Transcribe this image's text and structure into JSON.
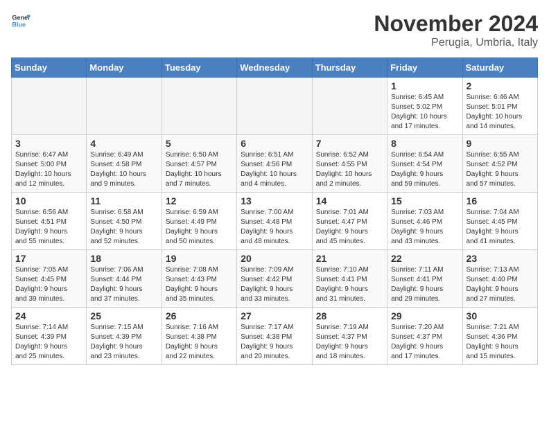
{
  "logo": {
    "text_general": "General",
    "text_blue": "Blue"
  },
  "header": {
    "month": "November 2024",
    "location": "Perugia, Umbria, Italy"
  },
  "weekdays": [
    "Sunday",
    "Monday",
    "Tuesday",
    "Wednesday",
    "Thursday",
    "Friday",
    "Saturday"
  ],
  "weeks": [
    [
      {
        "day": "",
        "info": ""
      },
      {
        "day": "",
        "info": ""
      },
      {
        "day": "",
        "info": ""
      },
      {
        "day": "",
        "info": ""
      },
      {
        "day": "",
        "info": ""
      },
      {
        "day": "1",
        "info": "Sunrise: 6:45 AM\nSunset: 5:02 PM\nDaylight: 10 hours\nand 17 minutes."
      },
      {
        "day": "2",
        "info": "Sunrise: 6:46 AM\nSunset: 5:01 PM\nDaylight: 10 hours\nand 14 minutes."
      }
    ],
    [
      {
        "day": "3",
        "info": "Sunrise: 6:47 AM\nSunset: 5:00 PM\nDaylight: 10 hours\nand 12 minutes."
      },
      {
        "day": "4",
        "info": "Sunrise: 6:49 AM\nSunset: 4:58 PM\nDaylight: 10 hours\nand 9 minutes."
      },
      {
        "day": "5",
        "info": "Sunrise: 6:50 AM\nSunset: 4:57 PM\nDaylight: 10 hours\nand 7 minutes."
      },
      {
        "day": "6",
        "info": "Sunrise: 6:51 AM\nSunset: 4:56 PM\nDaylight: 10 hours\nand 4 minutes."
      },
      {
        "day": "7",
        "info": "Sunrise: 6:52 AM\nSunset: 4:55 PM\nDaylight: 10 hours\nand 2 minutes."
      },
      {
        "day": "8",
        "info": "Sunrise: 6:54 AM\nSunset: 4:54 PM\nDaylight: 9 hours\nand 59 minutes."
      },
      {
        "day": "9",
        "info": "Sunrise: 6:55 AM\nSunset: 4:52 PM\nDaylight: 9 hours\nand 57 minutes."
      }
    ],
    [
      {
        "day": "10",
        "info": "Sunrise: 6:56 AM\nSunset: 4:51 PM\nDaylight: 9 hours\nand 55 minutes."
      },
      {
        "day": "11",
        "info": "Sunrise: 6:58 AM\nSunset: 4:50 PM\nDaylight: 9 hours\nand 52 minutes."
      },
      {
        "day": "12",
        "info": "Sunrise: 6:59 AM\nSunset: 4:49 PM\nDaylight: 9 hours\nand 50 minutes."
      },
      {
        "day": "13",
        "info": "Sunrise: 7:00 AM\nSunset: 4:48 PM\nDaylight: 9 hours\nand 48 minutes."
      },
      {
        "day": "14",
        "info": "Sunrise: 7:01 AM\nSunset: 4:47 PM\nDaylight: 9 hours\nand 45 minutes."
      },
      {
        "day": "15",
        "info": "Sunrise: 7:03 AM\nSunset: 4:46 PM\nDaylight: 9 hours\nand 43 minutes."
      },
      {
        "day": "16",
        "info": "Sunrise: 7:04 AM\nSunset: 4:45 PM\nDaylight: 9 hours\nand 41 minutes."
      }
    ],
    [
      {
        "day": "17",
        "info": "Sunrise: 7:05 AM\nSunset: 4:45 PM\nDaylight: 9 hours\nand 39 minutes."
      },
      {
        "day": "18",
        "info": "Sunrise: 7:06 AM\nSunset: 4:44 PM\nDaylight: 9 hours\nand 37 minutes."
      },
      {
        "day": "19",
        "info": "Sunrise: 7:08 AM\nSunset: 4:43 PM\nDaylight: 9 hours\nand 35 minutes."
      },
      {
        "day": "20",
        "info": "Sunrise: 7:09 AM\nSunset: 4:42 PM\nDaylight: 9 hours\nand 33 minutes."
      },
      {
        "day": "21",
        "info": "Sunrise: 7:10 AM\nSunset: 4:41 PM\nDaylight: 9 hours\nand 31 minutes."
      },
      {
        "day": "22",
        "info": "Sunrise: 7:11 AM\nSunset: 4:41 PM\nDaylight: 9 hours\nand 29 minutes."
      },
      {
        "day": "23",
        "info": "Sunrise: 7:13 AM\nSunset: 4:40 PM\nDaylight: 9 hours\nand 27 minutes."
      }
    ],
    [
      {
        "day": "24",
        "info": "Sunrise: 7:14 AM\nSunset: 4:39 PM\nDaylight: 9 hours\nand 25 minutes."
      },
      {
        "day": "25",
        "info": "Sunrise: 7:15 AM\nSunset: 4:39 PM\nDaylight: 9 hours\nand 23 minutes."
      },
      {
        "day": "26",
        "info": "Sunrise: 7:16 AM\nSunset: 4:38 PM\nDaylight: 9 hours\nand 22 minutes."
      },
      {
        "day": "27",
        "info": "Sunrise: 7:17 AM\nSunset: 4:38 PM\nDaylight: 9 hours\nand 20 minutes."
      },
      {
        "day": "28",
        "info": "Sunrise: 7:19 AM\nSunset: 4:37 PM\nDaylight: 9 hours\nand 18 minutes."
      },
      {
        "day": "29",
        "info": "Sunrise: 7:20 AM\nSunset: 4:37 PM\nDaylight: 9 hours\nand 17 minutes."
      },
      {
        "day": "30",
        "info": "Sunrise: 7:21 AM\nSunset: 4:36 PM\nDaylight: 9 hours\nand 15 minutes."
      }
    ]
  ]
}
